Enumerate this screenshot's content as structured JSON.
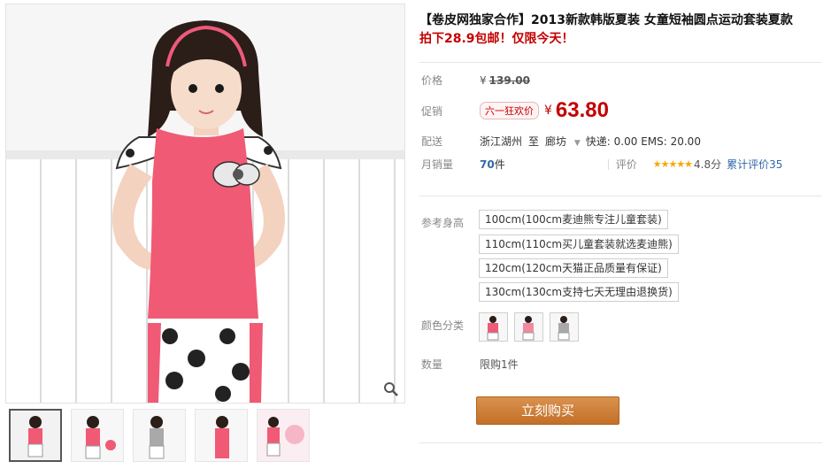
{
  "product": {
    "title": "【卷皮网独家合作】2013新款韩版夏装 女童短袖圆点运动套装夏款",
    "promo": "拍下28.9包邮！仅限今天！"
  },
  "price": {
    "label": "价格",
    "currency": "¥",
    "original": "139.00"
  },
  "sale": {
    "label": "促销",
    "badge": "六一狂欢价",
    "currency": "¥",
    "value": "63.80"
  },
  "shipping": {
    "label": "配送",
    "from": "浙江湖州",
    "to_word": "至",
    "destination": "廊坊",
    "fees": "快递: 0.00 EMS: 20.00"
  },
  "sales": {
    "label": "月销量",
    "count": "70",
    "unit": "件",
    "review_label": "评价",
    "stars": "★★★★★",
    "score": "4.8分",
    "total_reviews": "累计评价35"
  },
  "options": {
    "height_label": "参考身高",
    "heights": [
      "100cm(100cm麦迪熊专注儿童套装)",
      "110cm(110cm买儿童套装就选麦迪熊)",
      "120cm(120cm天猫正品质量有保证)",
      "130cm(130cm支持七天无理由退换货)"
    ],
    "color_label": "颜色分类",
    "qty_label": "数量",
    "qty_limit": "限购1件"
  },
  "buy_button": "立刻购买",
  "colors": {
    "accent_red": "#c40000",
    "shirt_pink": "#f05a75",
    "buy_orange": "#c9772f"
  },
  "icons": [
    "zoom-icon",
    "dropdown-arrow-icon",
    "star-rating-icon"
  ]
}
